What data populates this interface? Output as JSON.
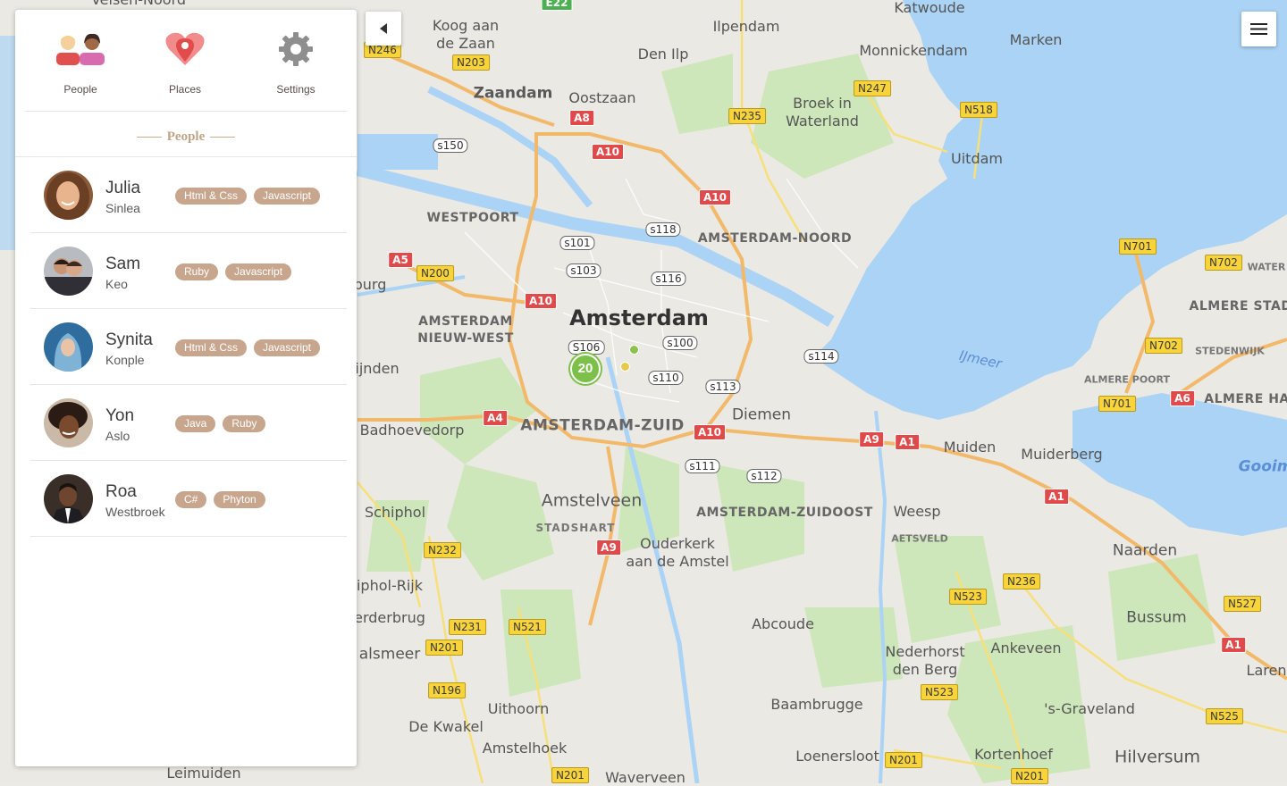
{
  "tabs": [
    {
      "label": "People",
      "icon": "people-icon"
    },
    {
      "label": "Places",
      "icon": "map-pin-heart-icon"
    },
    {
      "label": "Settings",
      "icon": "gear-icon"
    }
  ],
  "section_title": "People",
  "people": [
    {
      "first": "Julia",
      "last": "Sinlea",
      "tags": [
        "Html & Css",
        "Javascript"
      ]
    },
    {
      "first": "Sam",
      "last": "Keo",
      "tags": [
        "Ruby",
        "Javascript"
      ]
    },
    {
      "first": "Synita",
      "last": "Konple",
      "tags": [
        "Html & Css",
        "Javascript"
      ]
    },
    {
      "first": "Yon",
      "last": "Aslo",
      "tags": [
        "Java",
        "Ruby"
      ]
    },
    {
      "first": "Roa",
      "last": "Westbroek",
      "tags": [
        "C#",
        "Phyton"
      ]
    }
  ],
  "map": {
    "cluster_count": "20",
    "places": {
      "amsterdam": "Amsterdam",
      "zaandam": "Zaandam",
      "oostzaan": "Oostzaan",
      "koog": "Koog aan",
      "koog2": "de Zaan",
      "ilpendam": "Ilpendam",
      "den_ilp": "Den Ilp",
      "monnickendam": "Monnickendam",
      "katwoude": "Katwoude",
      "marken": "Marken",
      "broek": "Broek in",
      "broek2": "Waterland",
      "uitdam": "Uitdam",
      "westpoort": "WESTPOORT",
      "noord": "AMSTERDAM-NOORD",
      "nieuw_west": "AMSTERDAM",
      "nieuw_west2": "NIEUW-WEST",
      "zuid": "AMSTERDAM-ZUID",
      "zuidoost": "AMSTERDAM-ZUIDOOST",
      "diemen": "Diemen",
      "badhoevedorp": "Badhoevedorp",
      "schiphol": "Schiphol",
      "schiphol_rijk": "iphol-Rijk",
      "amstelveen": "Amstelveen",
      "stadshart": "STADSHART",
      "ouderkerk": "Ouderkerk",
      "ouderkerk2": "aan de Amstel",
      "weesp": "Weesp",
      "aetsveld": "AETSVELD",
      "muiden": "Muiden",
      "muiderberg": "Muiderberg",
      "naarden": "Naarden",
      "bussum": "Bussum",
      "abcoude": "Abcoude",
      "nederhorst": "Nederhorst",
      "nederhorst2": "den Berg",
      "ankeveen": "Ankeveen",
      "graveland": "'s-Graveland",
      "hilversum": "Hilversum",
      "kortenhoef": "Kortenhoef",
      "loenersloot": "Loenersloot",
      "baambrugge": "Baambrugge",
      "uithoorn": "Uithoorn",
      "de_kwakel": "De Kwakel",
      "amstelhoek": "Amstelhoek",
      "leimuiden": "Leimuiden",
      "aalsmeer": "alsmeer",
      "erderbrug": "erderbrug",
      "ijnden": "ijnden",
      "burg": "burg",
      "almere_stad": "ALMERE STAD",
      "almere_poort": "ALMERE POORT",
      "almere_ha": "ALMERE HA",
      "stedenwijk": "STEDENWIJK",
      "water": "WATER",
      "ijmeer": "IJmeer",
      "gooi": "Gooim",
      "laren": "Laren",
      "waverveen": "Waverveen",
      "velsen": "Velsen-Noord"
    },
    "roads": {
      "n246": "N246",
      "n203": "N203",
      "e22": "E22",
      "a8": "A8",
      "a10a": "A10",
      "a10b": "A10",
      "a10c": "A10",
      "a10d": "A10",
      "n247": "N247",
      "n235": "N235",
      "n518": "N518",
      "a5": "A5",
      "n200": "N200",
      "a4": "A4",
      "a9a": "A9",
      "a9b": "A9",
      "a1a": "A1",
      "a1b": "A1",
      "a1c": "A1",
      "a6": "A6",
      "n701a": "N701",
      "n701b": "N701",
      "n702a": "N702",
      "n702b": "N702",
      "n232": "N232",
      "n231": "N231",
      "n521": "N521",
      "n201a": "N201",
      "n201b": "N201",
      "n201c": "N201",
      "n201d": "N201",
      "n196": "N196",
      "n523a": "N523",
      "n523b": "N523",
      "n236": "N236",
      "n527": "N527",
      "n525": "N525",
      "s150": "s150",
      "s101": "s101",
      "s103": "s103",
      "s118": "s118",
      "s116": "s116",
      "s106": "S106",
      "s100": "s100",
      "s110": "s110",
      "s113": "s113",
      "s114": "s114",
      "s111": "s111",
      "s112": "s112"
    }
  }
}
